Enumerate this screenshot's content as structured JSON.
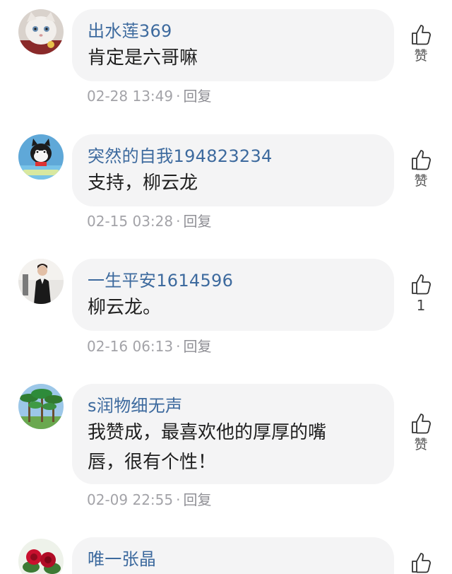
{
  "comments": [
    {
      "username": "出水莲369",
      "text": "肯定是六哥嘛",
      "time": "02-28 13:49",
      "separator": "·",
      "reply": "回复",
      "like": "赞",
      "avatar": "white-cat-avatar"
    },
    {
      "username": "突然的自我194823234",
      "text": "支持，柳云龙",
      "time": "02-15 03:28",
      "separator": "·",
      "reply": "回复",
      "like": "赞",
      "avatar": "cartoon-cat-avatar"
    },
    {
      "username": "一生平安1614596",
      "text": "柳云龙。",
      "time": "02-16 06:13",
      "separator": "·",
      "reply": "回复",
      "like": "1",
      "avatar": "person-photo-avatar"
    },
    {
      "username": "s润物细无声",
      "text_line1": "我赞成，最喜欢他的厚厚的嘴",
      "text_line2": "唇，很有个性！",
      "time": "02-09 22:55",
      "separator": "·",
      "reply": "回复",
      "like": "赞",
      "avatar": "palm-trees-avatar"
    },
    {
      "username": "唯一张晶",
      "avatar": "roses-avatar"
    }
  ],
  "colors": {
    "username": "#3d6a9e",
    "bubble": "#f4f4f5",
    "meta": "#a3a3a8"
  }
}
